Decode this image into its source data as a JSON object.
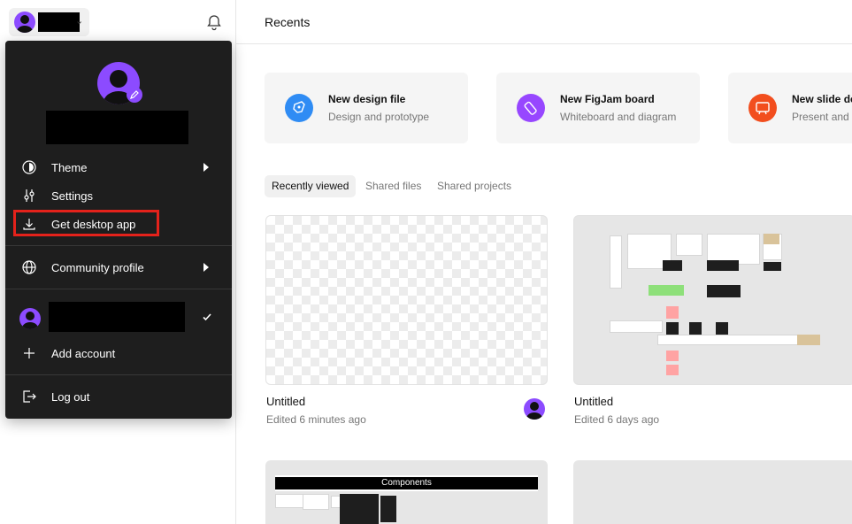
{
  "sidebar": {
    "account_chevron": "⌄"
  },
  "main": {
    "title": "Recents",
    "quick_actions": [
      {
        "title": "New design file",
        "subtitle": "Design and prototype",
        "color": "#2f8cf4"
      },
      {
        "title": "New FigJam board",
        "subtitle": "Whiteboard and diagram",
        "color": "#9747ff"
      },
      {
        "title": "New slide de",
        "subtitle": "Present and s",
        "color": "#f24e1e"
      }
    ],
    "tabs": [
      "Recently viewed",
      "Shared files",
      "Shared projects"
    ],
    "files": [
      {
        "name": "Untitled",
        "edited": "Edited 6 minutes ago"
      },
      {
        "name": "Untitled",
        "edited": "Edited 6 days ago"
      }
    ],
    "components_label": "Components"
  },
  "menu": {
    "items": {
      "theme": "Theme",
      "settings": "Settings",
      "get_desktop_app": "Get desktop app",
      "community_profile": "Community profile",
      "add_account": "Add account",
      "log_out": "Log out"
    },
    "highlight_color": "#e4221b"
  }
}
